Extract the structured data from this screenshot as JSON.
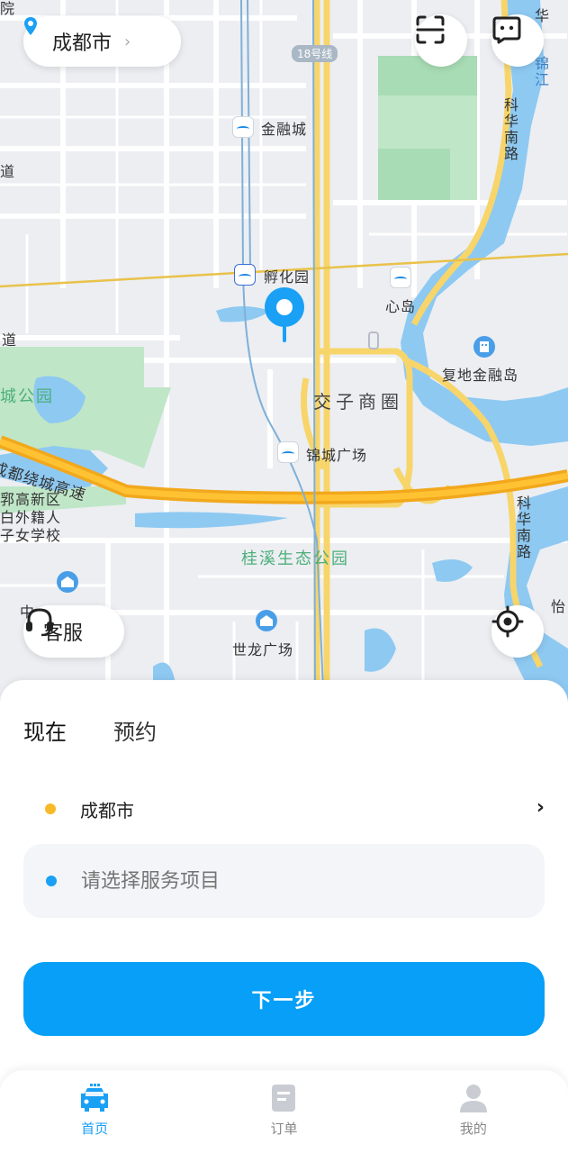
{
  "header": {
    "city": "成都市"
  },
  "map": {
    "metro_line_badge": "18号线",
    "labels": {
      "yuan": "院",
      "jinrongcheng": "金融城",
      "dao_left": "道",
      "dao_left2": "道",
      "fuhuayuan": "孵化园",
      "xindao": "心岛",
      "fudi": "复地金融岛",
      "chenggongyuan": "城公园",
      "jiaozi": "交子商圈",
      "jincheng": "锦城广场",
      "raocheng": "成都绕城高速",
      "gaoxin1": "郛高新区",
      "gaoxin2": "白外籍人",
      "gaoxin3": "子女学校",
      "guixi": "桂溪生态公园",
      "zhong": "中",
      "shilong": "世龙广场",
      "kehua_top": "科华南路",
      "kehua_bottom": "科华南路",
      "jiang": "锦江",
      "yi": "怡",
      "hua": "华"
    }
  },
  "controls": {
    "kefu": "客服"
  },
  "sheet": {
    "tabs": [
      "现在",
      "预约"
    ],
    "active_tab": "现在",
    "city_row": "成都市",
    "service_placeholder": "请选择服务项目",
    "next_button": "下一步"
  },
  "nav": {
    "items": [
      {
        "label": "首页",
        "icon": "car-icon",
        "active": true
      },
      {
        "label": "订单",
        "icon": "order-icon",
        "active": false
      },
      {
        "label": "我的",
        "icon": "user-icon",
        "active": false
      }
    ]
  },
  "colors": {
    "accent": "#079ff7",
    "dot_yellow": "#f8b928",
    "dot_blue": "#1aa0f5"
  }
}
